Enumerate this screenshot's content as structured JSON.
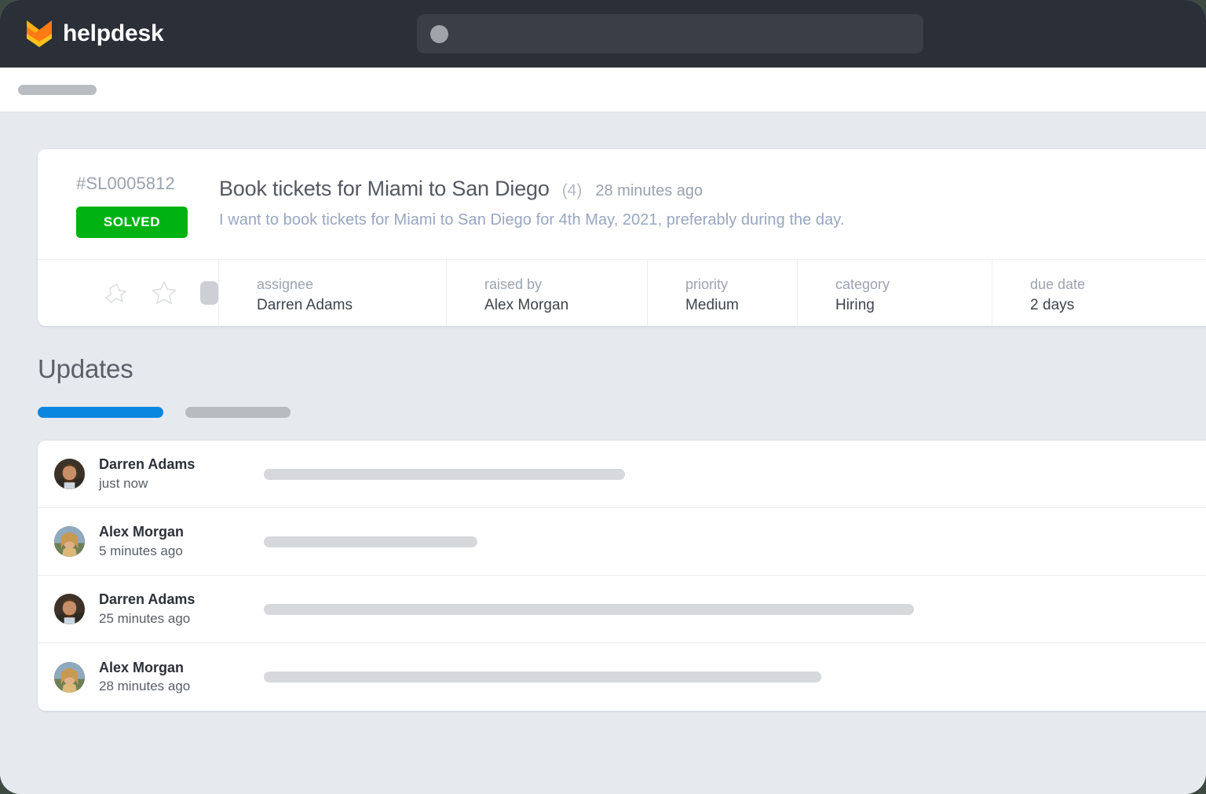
{
  "header": {
    "brand_name": "helpdesk",
    "logo_icon": "fox-chevron-logo",
    "search_placeholder": "",
    "search_value": "",
    "search_icon": "search-dot-placeholder"
  },
  "subbar": {
    "breadcrumb_placeholder": ""
  },
  "ticket": {
    "id": "#SL0005812",
    "status": "SOLVED",
    "status_color": "#00b312",
    "title": "Book tickets for Miami to San Diego",
    "comment_count": "(4)",
    "updated_time": "28 minutes ago",
    "description": "I want to book tickets for Miami to San Diego for 4th May, 2021, preferably during the day.",
    "actions": [
      {
        "icon": "pin-star-icon"
      },
      {
        "icon": "star-icon"
      },
      {
        "icon": "square-placeholder-icon"
      }
    ],
    "meta": [
      {
        "label": "assignee",
        "value": "Darren Adams"
      },
      {
        "label": "raised by",
        "value": "Alex Morgan"
      },
      {
        "label": "priority",
        "value": "Medium"
      },
      {
        "label": "category",
        "value": "Hiring"
      },
      {
        "label": "due date",
        "value": "2 days"
      }
    ]
  },
  "updates": {
    "heading": "Updates",
    "tabs": [
      {
        "name": "tab-active",
        "active": true,
        "color": "#0b86e0",
        "width": 160
      },
      {
        "name": "tab-inactive",
        "active": false,
        "color": "#b8bbc0",
        "width": 134
      }
    ],
    "items": [
      {
        "name": "Darren Adams",
        "time": "just now",
        "avatar": "avatar-darren",
        "body_width": 460
      },
      {
        "name": "Alex Morgan",
        "time": "5 minutes ago",
        "avatar": "avatar-alex",
        "body_width": 272
      },
      {
        "name": "Darren Adams",
        "time": "25 minutes ago",
        "avatar": "avatar-darren",
        "body_width": 828
      },
      {
        "name": "Alex Morgan",
        "time": "28 minutes ago",
        "avatar": "avatar-alex",
        "body_width": 710
      }
    ]
  }
}
